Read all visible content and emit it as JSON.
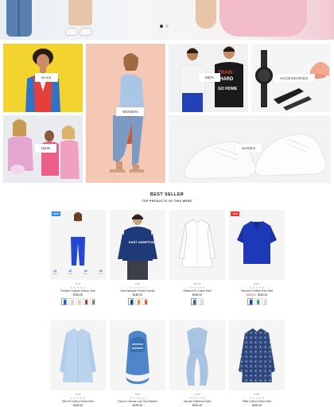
{
  "hero": {
    "slides": 2,
    "active_slide": 0
  },
  "categories": {
    "sale": "SALE",
    "women": "WOMEN",
    "men": "MEN",
    "accessories": "ACCESSORIES",
    "new": "NEW",
    "shoes": "SHOES"
  },
  "section": {
    "title": "BEST SELLER",
    "subtitle": "TOP PRODUCTS OF THIS WEEK"
  },
  "products": [
    {
      "badge": "NEW",
      "badge_color": "#2d8be0",
      "brand": "GAP",
      "stars": "★★★★★",
      "name": "Flexible Cropped Skinny Jean",
      "price": "$180.00",
      "sizes": [
        {
          "size": "24",
          "label": "Day"
        },
        {
          "size": "26",
          "label": "Day"
        },
        {
          "size": "28",
          "label": "Day"
        },
        {
          "size": "30",
          "label": "Day"
        }
      ],
      "colors": [
        "#2a56c9",
        "#f0f0f0",
        "#e9cfa8",
        "#c9342d",
        "#7a7a7a"
      ]
    },
    {
      "brand": "GAP",
      "stars": "★★★★★",
      "name": "East Hampton Fleece Hoodie",
      "price": "$180.00",
      "colors": [
        "#273f77",
        "#ff8a3d",
        "#e15a3a"
      ]
    },
    {
      "brand": "REISS",
      "stars": "★★★★★",
      "name": "Relaxed Fit Cotton Shirt",
      "price": "$180.00",
      "colors": [
        "#4a5f86",
        "#ffffff"
      ]
    },
    {
      "badge": "-15%",
      "badge_color": "#e8352f",
      "brand": "GAP",
      "stars": "★★★★★",
      "name": "Tailored Fit Mesh Polo Shirt",
      "price_old": "$168.00",
      "price": "$180.00",
      "colors": [
        "#1d39b8",
        "#2fae5b",
        "#ffffff"
      ]
    },
    {
      "brand": "GAP",
      "stars": "★★★★★",
      "name": "Slim Fit Cotton Oxford Shirt",
      "price": "$180.00"
    },
    {
      "brand": "GAP",
      "stars": "★★★★★",
      "name": "Faux-In Canvas Low-Top Sneaker",
      "price": "$180.00"
    },
    {
      "brand": "GAP",
      "stars": "★★★★★",
      "name": "Viscose Gathered Scarf",
      "price": "$180.00"
    },
    {
      "brand": "GAP",
      "stars": "★★★★★",
      "name": "Plaid Cotton Oxford Shirt",
      "price": "$180.00"
    }
  ]
}
